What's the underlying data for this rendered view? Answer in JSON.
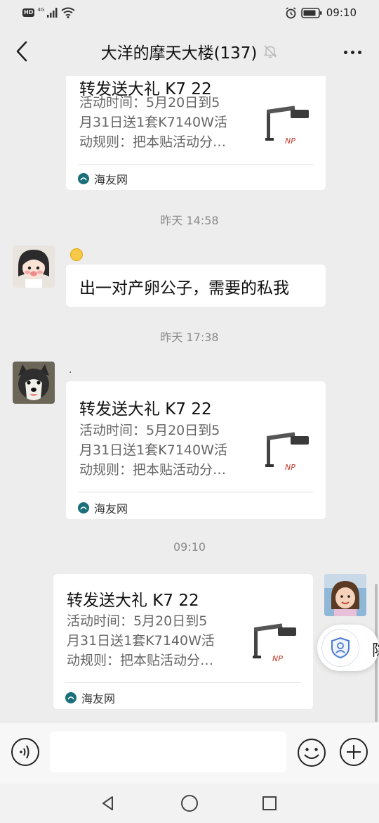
{
  "status_bar": {
    "hd": "HD",
    "network": "4G",
    "time": "09:10"
  },
  "header": {
    "title": "大洋的摩天大楼(137)"
  },
  "messages": [
    {
      "type": "link_card",
      "title": "转发送大礼 K7 22",
      "desc_lines": [
        "活动时间：5月20日到5",
        "月31日送1套K7140W活",
        "动规则：把本贴活动分…"
      ],
      "source": "海友网"
    },
    {
      "type": "timestamp",
      "text": "昨天 14:58"
    },
    {
      "type": "text",
      "text": "出一对产卵公子，需要的私我"
    },
    {
      "type": "timestamp",
      "text": "昨天 17:38"
    },
    {
      "type": "link_card",
      "sender_name": ".",
      "title": "转发送大礼 K7 22",
      "desc_lines": [
        "活动时间：5月20日到5",
        "月31日送1套K7140W活",
        "动规则：把本贴活动分…"
      ],
      "source": "海友网"
    },
    {
      "type": "timestamp",
      "text": "09:10"
    },
    {
      "type": "link_card",
      "title": "转发送大礼 K7 22",
      "desc_lines": [
        "活动时间：5月20日到5",
        "月31日送1套K7140W活",
        "动规则：把本贴活动分…"
      ],
      "source": "海友网"
    }
  ],
  "floating_assistant": {
    "label": "隐"
  },
  "input": {
    "value": "",
    "placeholder": ""
  },
  "icons": {
    "back": "chevron-left-icon",
    "mute": "bell-off-icon",
    "more": "more-dots-icon",
    "voice": "voice-icon",
    "emoji": "emoji-icon",
    "plus": "plus-icon"
  }
}
